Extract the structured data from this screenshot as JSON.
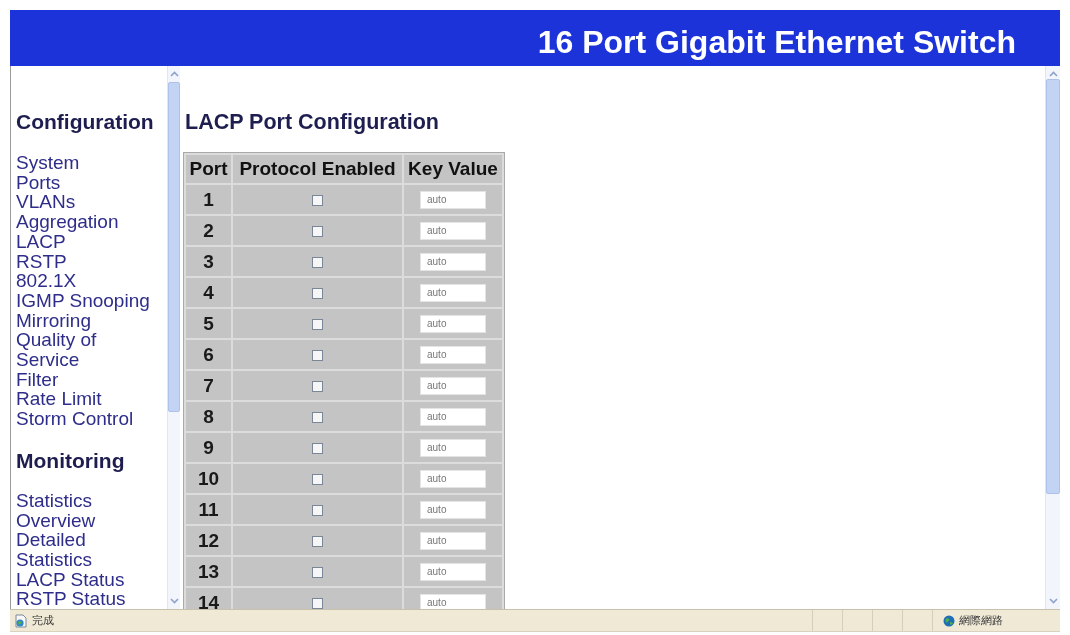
{
  "header": {
    "title": "16 Port Gigabit Ethernet Switch"
  },
  "sidebar": {
    "sections": [
      {
        "heading": "Configuration",
        "items": [
          "System",
          "Ports",
          "VLANs",
          "Aggregation",
          "LACP",
          "RSTP",
          "802.1X",
          "IGMP Snooping",
          "Mirroring",
          "Quality of Service",
          "Filter",
          "Rate Limit",
          "Storm Control"
        ]
      },
      {
        "heading": "Monitoring",
        "items": [
          "Statistics Overview",
          "Detailed Statistics",
          "LACP Status",
          "RSTP Status"
        ]
      }
    ]
  },
  "main": {
    "heading": "LACP Port Configuration",
    "table": {
      "columns": [
        "Port",
        "Protocol Enabled",
        "Key Value"
      ],
      "rows": [
        {
          "port": "1",
          "protocol_enabled": false,
          "key_value": "auto"
        },
        {
          "port": "2",
          "protocol_enabled": false,
          "key_value": "auto"
        },
        {
          "port": "3",
          "protocol_enabled": false,
          "key_value": "auto"
        },
        {
          "port": "4",
          "protocol_enabled": false,
          "key_value": "auto"
        },
        {
          "port": "5",
          "protocol_enabled": false,
          "key_value": "auto"
        },
        {
          "port": "6",
          "protocol_enabled": false,
          "key_value": "auto"
        },
        {
          "port": "7",
          "protocol_enabled": false,
          "key_value": "auto"
        },
        {
          "port": "8",
          "protocol_enabled": false,
          "key_value": "auto"
        },
        {
          "port": "9",
          "protocol_enabled": false,
          "key_value": "auto"
        },
        {
          "port": "10",
          "protocol_enabled": false,
          "key_value": "auto"
        },
        {
          "port": "11",
          "protocol_enabled": false,
          "key_value": "auto"
        },
        {
          "port": "12",
          "protocol_enabled": false,
          "key_value": "auto"
        },
        {
          "port": "13",
          "protocol_enabled": false,
          "key_value": "auto"
        },
        {
          "port": "14",
          "protocol_enabled": false,
          "key_value": "auto"
        }
      ]
    }
  },
  "status_bar": {
    "status": "完成",
    "zone": "網際網路"
  }
}
